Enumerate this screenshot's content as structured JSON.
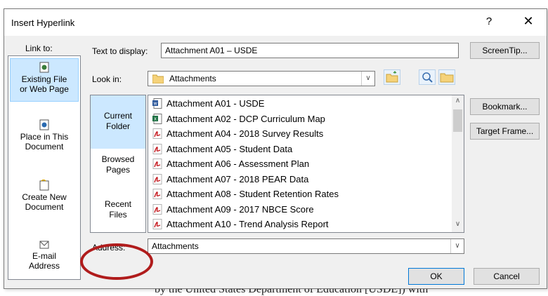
{
  "document": {
    "background_text": "by the United States Department of Education [USDE]) with"
  },
  "dialog": {
    "title": "Insert Hyperlink",
    "help_label": "?",
    "close_label": "✕"
  },
  "link_to": {
    "label": "Link to:",
    "items": [
      {
        "line1": "Existing File",
        "line2": "or Web Page",
        "icon": "web-page-icon",
        "selected": true
      },
      {
        "line1": "Place in This",
        "line2": "Document",
        "icon": "place-in-document-icon"
      },
      {
        "line1": "Create New",
        "line2": "Document",
        "icon": "new-document-icon"
      },
      {
        "line1": "E-mail",
        "line2": "Address",
        "icon": "email-icon"
      }
    ]
  },
  "text_to_display": {
    "label": "Text to display:",
    "value": "Attachment A01 – USDE"
  },
  "screentip_label": "ScreenTip...",
  "look_in": {
    "label": "Look in:",
    "value": "Attachments"
  },
  "tabs": [
    {
      "line1": "Current",
      "line2": "Folder",
      "selected": true
    },
    {
      "line1": "Browsed",
      "line2": "Pages"
    },
    {
      "line1": "Recent",
      "line2": "Files"
    }
  ],
  "files": [
    {
      "name": "Attachment A01 - USDE",
      "type": "word"
    },
    {
      "name": "Attachment A02 - DCP Curriculum Map",
      "type": "excel"
    },
    {
      "name": "Attachment A04 - 2018 Survey Results",
      "type": "pdf"
    },
    {
      "name": "Attachment A05 - Student Data",
      "type": "pdf"
    },
    {
      "name": "Attachment A06 - Assessment Plan",
      "type": "pdf"
    },
    {
      "name": "Attachment A07 - 2018 PEAR Data",
      "type": "pdf"
    },
    {
      "name": "Attachment A08 - Student Retention Rates",
      "type": "pdf"
    },
    {
      "name": "Attachment A09 - 2017 NBCE Score",
      "type": "pdf"
    },
    {
      "name": "Attachment A10 - Trend Analysis Report",
      "type": "pdf"
    }
  ],
  "right_buttons": {
    "bookmark": "Bookmark...",
    "target_frame": "Target Frame..."
  },
  "address": {
    "label": "Address:",
    "value": "Attachments"
  },
  "ok_label": "OK",
  "cancel_label": "Cancel",
  "colors": {
    "selection": "#cce8ff",
    "annotation_circle": "#b01c1c",
    "accent": "#0078d7"
  }
}
